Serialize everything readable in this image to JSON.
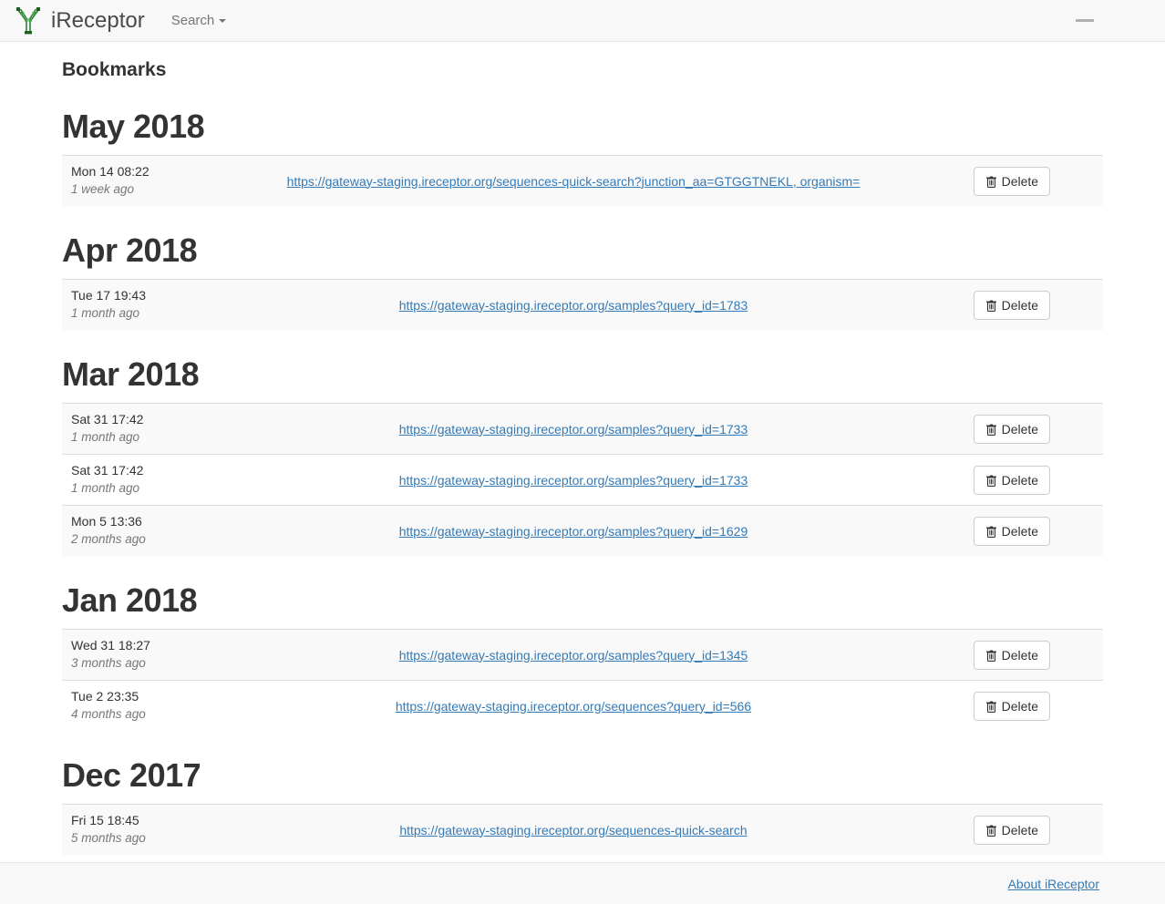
{
  "navbar": {
    "brand_label": "iReceptor",
    "brand_logo_icon": "antibody-y-logo",
    "search_label": "Search",
    "caret_icon": "caret-down-icon"
  },
  "main": {
    "page_title": "Bookmarks",
    "delete_label": "Delete",
    "trash_icon": "trash-icon",
    "months": [
      {
        "heading": "May 2018",
        "rows": [
          {
            "date": "Mon 14 08:22",
            "relative": "1 week ago",
            "url": "https://gateway-staging.ireceptor.org/sequences-quick-search?junction_aa=GTGGTNEKL, organism=",
            "delete_label": "Delete"
          }
        ]
      },
      {
        "heading": "Apr 2018",
        "rows": [
          {
            "date": "Tue 17 19:43",
            "relative": "1 month ago",
            "url": "https://gateway-staging.ireceptor.org/samples?query_id=1783",
            "delete_label": "Delete"
          }
        ]
      },
      {
        "heading": "Mar 2018",
        "rows": [
          {
            "date": "Sat 31 17:42",
            "relative": "1 month ago",
            "url": "https://gateway-staging.ireceptor.org/samples?query_id=1733",
            "delete_label": "Delete"
          },
          {
            "date": "Sat 31 17:42",
            "relative": "1 month ago",
            "url": "https://gateway-staging.ireceptor.org/samples?query_id=1733",
            "delete_label": "Delete"
          },
          {
            "date": "Mon 5 13:36",
            "relative": "2 months ago",
            "url": "https://gateway-staging.ireceptor.org/samples?query_id=1629",
            "delete_label": "Delete"
          }
        ]
      },
      {
        "heading": "Jan 2018",
        "rows": [
          {
            "date": "Wed 31 18:27",
            "relative": "3 months ago",
            "url": "https://gateway-staging.ireceptor.org/samples?query_id=1345",
            "delete_label": "Delete"
          },
          {
            "date": "Tue 2 23:35",
            "relative": "4 months ago",
            "url": "https://gateway-staging.ireceptor.org/sequences?query_id=566",
            "delete_label": "Delete"
          }
        ]
      },
      {
        "heading": "Dec 2017",
        "rows": [
          {
            "date": "Fri 15 18:45",
            "relative": "5 months ago",
            "url": "https://gateway-staging.ireceptor.org/sequences-quick-search",
            "delete_label": "Delete"
          }
        ]
      }
    ]
  },
  "footer": {
    "about_label": "About iReceptor"
  },
  "colors": {
    "link": "#337ab7",
    "navbar_bg": "#f8f8f8",
    "stripe_bg": "#f9f9f9",
    "border": "#dddddd",
    "logo_green": "#4caf50",
    "logo_dark": "#1b5e20"
  }
}
